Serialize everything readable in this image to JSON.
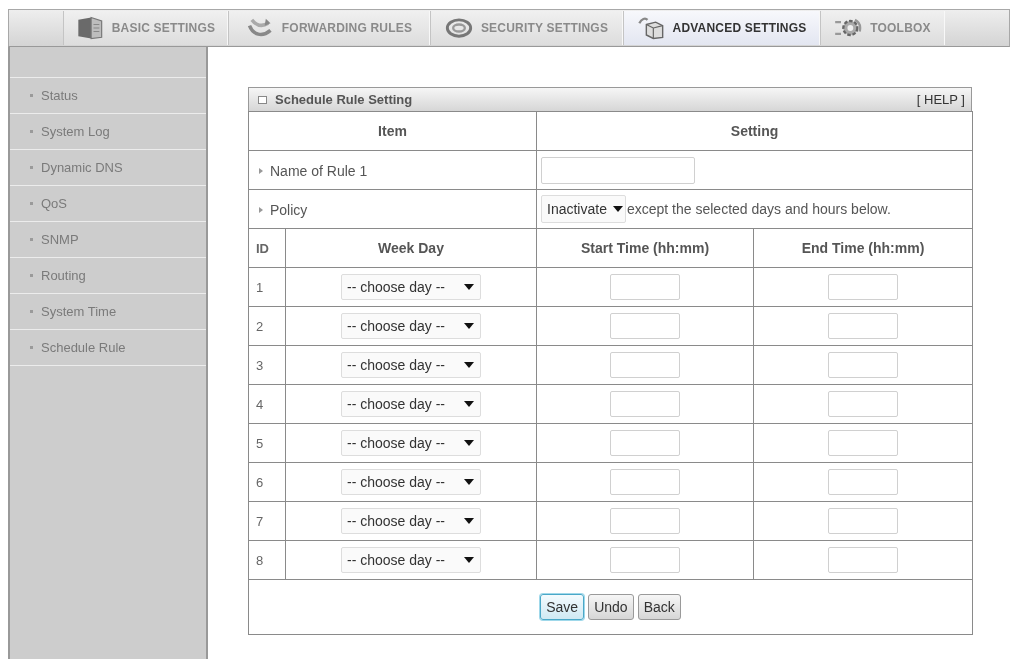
{
  "tabs": [
    {
      "label": "BASIC SETTINGS",
      "selected": false
    },
    {
      "label": "FORWARDING RULES",
      "selected": false
    },
    {
      "label": "SECURITY SETTINGS",
      "selected": false
    },
    {
      "label": "ADVANCED SETTINGS",
      "selected": true
    },
    {
      "label": "TOOLBOX",
      "selected": false
    }
  ],
  "sidebar": {
    "items": [
      {
        "label": "Status"
      },
      {
        "label": "System Log"
      },
      {
        "label": "Dynamic DNS"
      },
      {
        "label": "QoS"
      },
      {
        "label": "SNMP"
      },
      {
        "label": "Routing"
      },
      {
        "label": "System Time"
      },
      {
        "label": "Schedule Rule"
      }
    ]
  },
  "panel": {
    "title": "Schedule Rule Setting",
    "help": "[ HELP ]"
  },
  "settings": {
    "columns": [
      "Item",
      "Setting"
    ],
    "rows": [
      {
        "kind": "text",
        "label": "Name of Rule 1"
      },
      {
        "kind": "select",
        "label": "Policy",
        "value": "Inactivate",
        "note": "except the selected days and hours below."
      }
    ]
  },
  "schedule": {
    "columns": [
      "ID",
      "Week Day",
      "Start Time (hh:mm)",
      "End Time (hh:mm)"
    ],
    "rows": [
      {
        "id": "1",
        "day": "-- choose day --"
      },
      {
        "id": "2",
        "day": "-- choose day --"
      },
      {
        "id": "3",
        "day": "-- choose day --"
      },
      {
        "id": "4",
        "day": "-- choose day --"
      },
      {
        "id": "5",
        "day": "-- choose day --"
      },
      {
        "id": "6",
        "day": "-- choose day --"
      },
      {
        "id": "7",
        "day": "-- choose day --"
      },
      {
        "id": "8",
        "day": "-- choose day --"
      }
    ]
  },
  "buttons": [
    {
      "label": "Save",
      "focused": true
    },
    {
      "label": "Undo",
      "focused": false
    },
    {
      "label": "Back",
      "focused": false
    }
  ]
}
